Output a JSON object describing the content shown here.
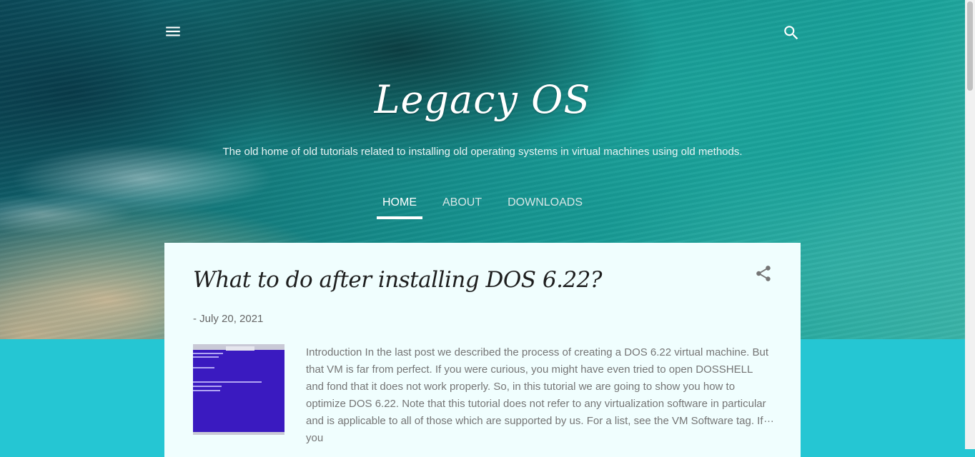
{
  "header": {
    "title": "Legacy OS",
    "description": "The old home of old tutorials related to installing old operating systems in virtual machines using old methods.",
    "menu_icon": "menu-icon",
    "search_icon": "search-icon"
  },
  "nav": {
    "tabs": [
      {
        "label": "HOME",
        "active": true
      },
      {
        "label": "ABOUT",
        "active": false
      },
      {
        "label": "DOWNLOADS",
        "active": false
      }
    ]
  },
  "post": {
    "title": "What to do after installing DOS 6.22?",
    "date": "- July 20, 2021",
    "share_icon": "share-icon",
    "excerpt": "Introduction In the last post we described the process of creating a DOS 6.22 virtual machine. But that VM is far from perfect. If you were curious, you might have even tried to open DOSSHELL and fond that it does not work properly. So, in this tutorial we are going to show you how to optimize DOS 6.22. Note that this tutorial does not refer to any virtualization software in particular and is applicable to all of those which are supported by us. For a list, see the VM Software tag. If you",
    "ellipsis": "…"
  },
  "colors": {
    "lower_background": "#25c6d3",
    "card_background": "#f0fefe",
    "thumbnail_blue": "#3a1ac0"
  }
}
